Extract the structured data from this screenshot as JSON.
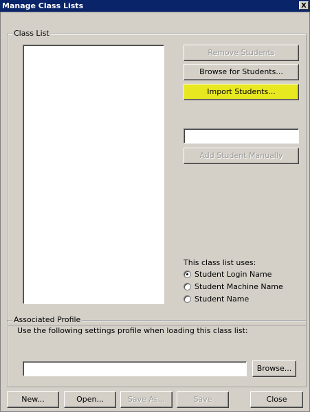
{
  "window": {
    "title": "Manage Class Lists",
    "close_symbol": "X"
  },
  "class_list": {
    "group_label": "Class List",
    "items": [],
    "remove_students": "Remove Students",
    "browse_students": "Browse for Students...",
    "import_students": "Import Students...",
    "manual_student_value": "",
    "add_manually": "Add Student Manually",
    "uses_label": "This class list uses:",
    "options": [
      {
        "label": "Student Login Name",
        "selected": true
      },
      {
        "label": "Student Machine Name",
        "selected": false
      },
      {
        "label": "Student Name",
        "selected": false
      }
    ]
  },
  "profile": {
    "group_label": "Associated Profile",
    "description": "Use the following settings profile when loading this class list:",
    "path_value": "",
    "browse": "Browse..."
  },
  "footer": {
    "new": "New...",
    "open": "Open...",
    "save_as": "Save As...",
    "save": "Save",
    "close": "Close"
  },
  "colors": {
    "title_bar": "#0a246a",
    "face": "#d4d0c8",
    "highlight": "#e8e820"
  }
}
